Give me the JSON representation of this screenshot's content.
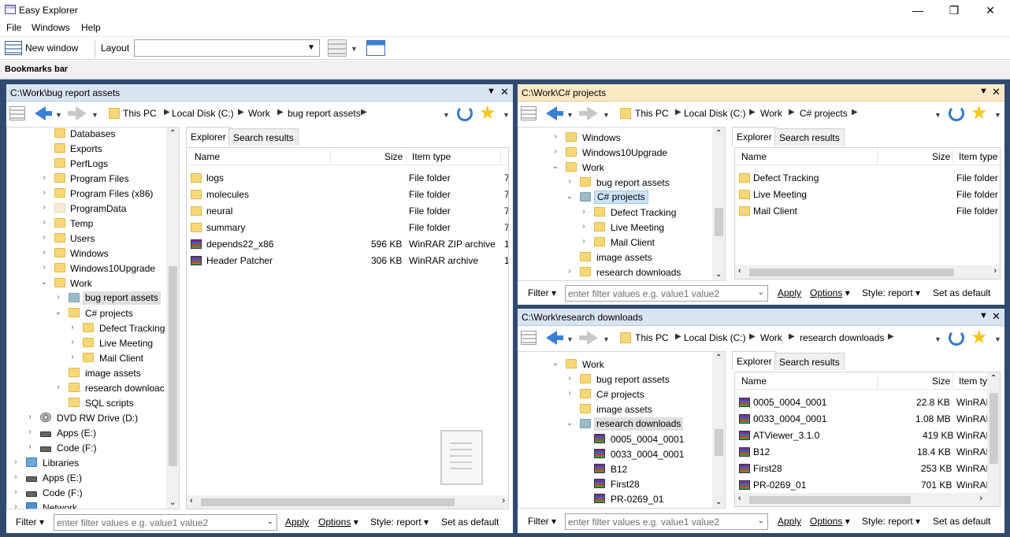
{
  "app": {
    "title": "Easy Explorer"
  },
  "window_controls": {
    "minimize": "—",
    "maximize": "❐",
    "close": "✕"
  },
  "menu": [
    "File",
    "Windows",
    "Help"
  ],
  "toolbar": {
    "new_window": "New window",
    "layout_label": "Layout",
    "layout_value": ""
  },
  "bookmarks_bar": "Bookmarks bar",
  "filter": {
    "label": "Filter",
    "placeholder": "enter filter values e.g. value1 value2",
    "apply": "Apply",
    "options": "Options",
    "style": "Style: report",
    "set_default": "Set as default"
  },
  "tabs": {
    "explorer": "Explorer",
    "search": "Search results"
  },
  "columns": {
    "name": "Name",
    "size": "Size",
    "type": "Item type"
  },
  "pane1": {
    "title": "C:\\Work\\bug report assets",
    "breadcrumb": [
      "This PC",
      "Local Disk (C:)",
      "Work",
      "bug report assets"
    ],
    "tree": [
      {
        "label": "Databases",
        "icon": "folder"
      },
      {
        "label": "Exports",
        "icon": "folder"
      },
      {
        "label": "PerfLogs",
        "icon": "folder"
      },
      {
        "label": "Program Files",
        "icon": "folder"
      },
      {
        "label": "Program Files (x86)",
        "icon": "folder"
      },
      {
        "label": "ProgramData",
        "icon": "folder-pale"
      },
      {
        "label": "Temp",
        "icon": "folder"
      },
      {
        "label": "Users",
        "icon": "folder"
      },
      {
        "label": "Windows",
        "icon": "folder"
      },
      {
        "label": "Windows10Upgrade",
        "icon": "folder"
      },
      {
        "label": "Work",
        "icon": "folder"
      },
      {
        "label": "bug report assets",
        "icon": "folder-selected"
      },
      {
        "label": "C# projects",
        "icon": "folder"
      },
      {
        "label": "Defect Tracking",
        "icon": "folder"
      },
      {
        "label": "Live Meeting",
        "icon": "folder"
      },
      {
        "label": "Mail Client",
        "icon": "folder"
      },
      {
        "label": "image assets",
        "icon": "folder"
      },
      {
        "label": "research downloac",
        "icon": "folder"
      },
      {
        "label": "SQL scripts",
        "icon": "folder"
      },
      {
        "label": "DVD RW Drive (D:)",
        "icon": "dvd"
      },
      {
        "label": "Apps (E:)",
        "icon": "drive"
      },
      {
        "label": "Code (F:)",
        "icon": "drive"
      },
      {
        "label": "Libraries",
        "icon": "library"
      },
      {
        "label": "Apps (E:)",
        "icon": "drive"
      },
      {
        "label": "Code (F:)",
        "icon": "drive"
      },
      {
        "label": "Network",
        "icon": "network"
      }
    ],
    "files": [
      {
        "name": "logs",
        "size": "",
        "type": "File folder",
        "extra": "7",
        "icon": "folder"
      },
      {
        "name": "molecules",
        "size": "",
        "type": "File folder",
        "extra": "7",
        "icon": "folder"
      },
      {
        "name": "neural",
        "size": "",
        "type": "File folder",
        "extra": "7",
        "icon": "folder"
      },
      {
        "name": "summary",
        "size": "",
        "type": "File folder",
        "extra": "7",
        "icon": "folder"
      },
      {
        "name": "depends22_x86",
        "size": "596 KB",
        "type": "WinRAR ZIP archive",
        "extra": "1",
        "icon": "rar"
      },
      {
        "name": "Header Patcher",
        "size": "306 KB",
        "type": "WinRAR archive",
        "extra": "1",
        "icon": "rar"
      }
    ]
  },
  "pane2": {
    "title": "C:\\Work\\C# projects",
    "breadcrumb": [
      "This PC",
      "Local Disk (C:)",
      "Work",
      "C# projects"
    ],
    "tree": [
      {
        "label": "Windows"
      },
      {
        "label": "Windows10Upgrade"
      },
      {
        "label": "Work"
      },
      {
        "label": "bug report assets"
      },
      {
        "label": "C# projects"
      },
      {
        "label": "Defect Tracking"
      },
      {
        "label": "Live Meeting"
      },
      {
        "label": "Mail Client"
      },
      {
        "label": "image assets"
      },
      {
        "label": "research downloads"
      }
    ],
    "files": [
      {
        "name": "Defect Tracking",
        "type": "File folder"
      },
      {
        "name": "Live Meeting",
        "type": "File folder"
      },
      {
        "name": "Mail Client",
        "type": "File folder"
      }
    ]
  },
  "pane3": {
    "title": "C:\\Work\\research downloads",
    "breadcrumb": [
      "This PC",
      "Local Disk (C:)",
      "Work",
      "research downloads"
    ],
    "tree": [
      {
        "label": "Work"
      },
      {
        "label": "bug report assets"
      },
      {
        "label": "C# projects"
      },
      {
        "label": "image assets"
      },
      {
        "label": "research downloads"
      },
      {
        "label": "0005_0004_0001"
      },
      {
        "label": "0033_0004_0001"
      },
      {
        "label": "B12"
      },
      {
        "label": "First28"
      },
      {
        "label": "PR-0269_01"
      }
    ],
    "type_header": "Item ty",
    "files": [
      {
        "name": "0005_0004_0001",
        "size": "22.8 KB",
        "type": "WinRAI"
      },
      {
        "name": "0033_0004_0001",
        "size": "1.08 MB",
        "type": "WinRAI"
      },
      {
        "name": "ATViewer_3.1.0",
        "size": "419 KB",
        "type": "WinRAI"
      },
      {
        "name": "B12",
        "size": "18.4 KB",
        "type": "WinRAI"
      },
      {
        "name": "First28",
        "size": "253 KB",
        "type": "WinRAI"
      },
      {
        "name": "PR-0269_01",
        "size": "701 KB",
        "type": "WinRAI"
      }
    ]
  }
}
